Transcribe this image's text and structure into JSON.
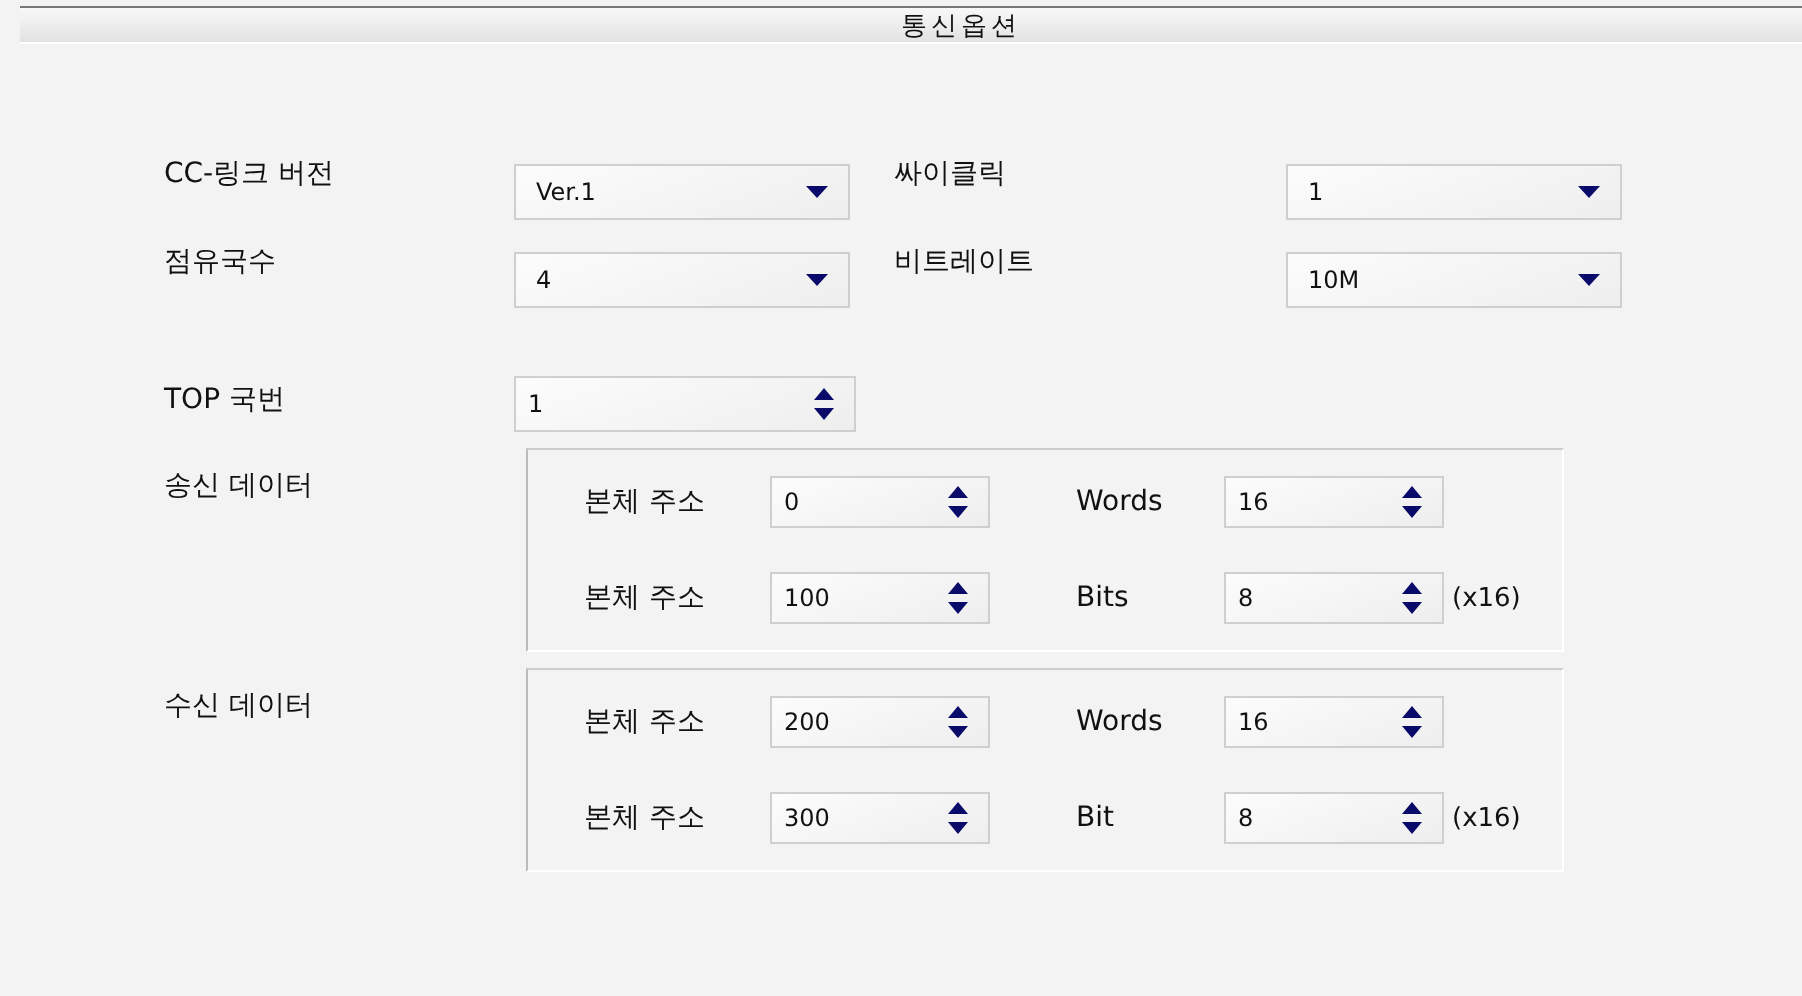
{
  "title": "통신옵션",
  "settings": [
    {
      "label": "CC-링크 버전",
      "value": "Ver.1",
      "kind": "dropdown"
    },
    {
      "label": "싸이클릭",
      "value": "1",
      "kind": "dropdown"
    },
    {
      "label": "점유국수",
      "value": "4",
      "kind": "dropdown"
    },
    {
      "label": "비트레이트",
      "value": "10M",
      "kind": "dropdown"
    }
  ],
  "top_station": {
    "label": "TOP 국번",
    "value": "1"
  },
  "groups": [
    {
      "label": "송신 데이터",
      "rows": [
        {
          "address_label": "본체 주소",
          "address_value": "0",
          "count_label": "Words",
          "count_value": "16"
        },
        {
          "address_label": "본체 주소",
          "address_value": "100",
          "count_label": "Bits",
          "count_value": "8",
          "unit": "(x16)"
        }
      ]
    },
    {
      "label": "수신 데이터",
      "rows": [
        {
          "address_label": "본체 주소",
          "address_value": "200",
          "count_label": "Words",
          "count_value": "16"
        },
        {
          "address_label": "본체 주소",
          "address_value": "300",
          "count_label": "Bit",
          "count_value": "8",
          "unit": "(x16)"
        }
      ]
    }
  ]
}
